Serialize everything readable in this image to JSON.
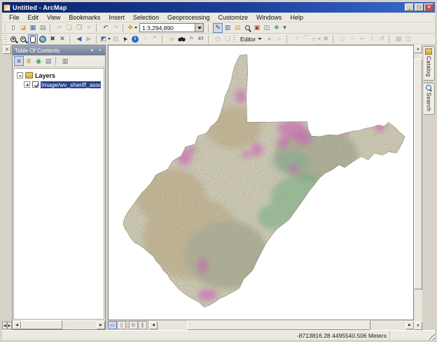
{
  "window": {
    "title": "Untitled - ArcMap"
  },
  "titlebar_controls": [
    {
      "name": "minimize-button",
      "glyph": "_"
    },
    {
      "name": "maximize-button",
      "glyph": "□"
    },
    {
      "name": "close-button",
      "glyph": "×"
    }
  ],
  "menu": {
    "items": [
      {
        "name": "menu-file",
        "label": "File"
      },
      {
        "name": "menu-edit",
        "label": "Edit"
      },
      {
        "name": "menu-view",
        "label": "View"
      },
      {
        "name": "menu-bookmarks",
        "label": "Bookmarks"
      },
      {
        "name": "menu-insert",
        "label": "Insert"
      },
      {
        "name": "menu-selection",
        "label": "Selection"
      },
      {
        "name": "menu-geoprocessing",
        "label": "Geoprocessing"
      },
      {
        "name": "menu-customize",
        "label": "Customize"
      },
      {
        "name": "menu-windows",
        "label": "Windows"
      },
      {
        "name": "menu-help",
        "label": "Help"
      }
    ]
  },
  "standard_toolbar": {
    "scale_value": "1:3,294,890",
    "buttons_left": [
      {
        "name": "new-map-button",
        "glyph": "▯",
        "color": "#556"
      },
      {
        "name": "open-button",
        "glyph": "◪",
        "color": "#d9a33c"
      },
      {
        "name": "save-button",
        "glyph": "▦",
        "color": "#3b5fc0"
      },
      {
        "name": "print-button",
        "glyph": "▤",
        "color": "#7d8494"
      },
      {
        "sep": true
      },
      {
        "name": "cut-button",
        "glyph": "✂",
        "color": "#556",
        "disabled": true
      },
      {
        "name": "copy-button",
        "glyph": "❏",
        "color": "#556",
        "disabled": true
      },
      {
        "name": "paste-button",
        "glyph": "❒",
        "color": "#b9862f"
      },
      {
        "name": "delete-button",
        "glyph": "×",
        "color": "#a33",
        "disabled": true
      },
      {
        "sep": true
      },
      {
        "name": "undo-button",
        "glyph": "↶",
        "color": "#2f58c2"
      },
      {
        "name": "redo-button",
        "glyph": "↷",
        "color": "#667",
        "disabled": true
      },
      {
        "sep": true
      },
      {
        "name": "add-data-button",
        "glyph": "✚",
        "color": "#caa225",
        "dd": true
      }
    ],
    "buttons_right": [
      {
        "name": "editor-toolbar-toggle-button",
        "glyph": "✎",
        "color": "#445",
        "pressed": true
      },
      {
        "name": "table-of-contents-window-button",
        "glyph": "▥",
        "color": "#3b5fc0"
      },
      {
        "name": "catalog-window-button",
        "glyph": "▤",
        "color": "#d9a33c"
      },
      {
        "name": "search-window-button",
        "cls": "ico-magnifier"
      },
      {
        "name": "arctoolbox-window-button",
        "glyph": "▣",
        "color": "#c23b2f"
      },
      {
        "name": "python-window-button",
        "glyph": "◫",
        "color": "#667"
      },
      {
        "name": "modelbuilder-button",
        "glyph": "❖",
        "color": "#3aa05a"
      },
      {
        "name": "toolbar-overflow-button",
        "glyph": "▾",
        "color": "#556",
        "cls": "overflow"
      }
    ]
  },
  "tools_toolbar": {
    "buttons": [
      {
        "name": "zoom-in-button",
        "cls": "ico-zoom-in"
      },
      {
        "name": "zoom-out-button",
        "cls": "ico-zoom-out"
      },
      {
        "name": "pan-button",
        "cls": "ico-hand",
        "pressed": true
      },
      {
        "name": "full-extent-button",
        "cls": "ico-globe"
      },
      {
        "name": "fixed-zoom-in-button",
        "glyph": "✖",
        "color": "#2f3f66"
      },
      {
        "name": "fixed-zoom-out-button",
        "glyph": "✕",
        "color": "#2f3f66"
      },
      {
        "sep": true
      },
      {
        "name": "go-back-extent-button",
        "glyph": "◀",
        "color": "#2f58c2"
      },
      {
        "name": "go-forward-extent-button",
        "glyph": "▶",
        "color": "#667",
        "disabled": true
      },
      {
        "sep": true
      },
      {
        "name": "select-features-button",
        "glyph": "◩",
        "color": "#5a6ab0",
        "dd": true
      },
      {
        "name": "clear-selection-button",
        "glyph": "▨",
        "color": "#667",
        "disabled": true
      },
      {
        "name": "select-elements-button",
        "glyph": "➤",
        "color": "#1a1a1a",
        "cls": "rot-up"
      },
      {
        "name": "identify-button",
        "glyph": "i",
        "cls": "ico-info"
      },
      {
        "name": "hyperlink-button",
        "glyph": "⚡",
        "color": "#caa225",
        "disabled": true
      },
      {
        "name": "html-popup-button",
        "glyph": "❞",
        "color": "#667",
        "disabled": true
      },
      {
        "sep": true
      },
      {
        "name": "measure-button",
        "glyph": "▱",
        "color": "#b9862f"
      },
      {
        "name": "find-button",
        "cls": "ico-binoculars"
      },
      {
        "name": "find-route-button",
        "glyph": "⚑",
        "color": "#667",
        "disabled": true
      },
      {
        "name": "go-to-xy-button",
        "glyph": "XY",
        "color": "#2f58c2",
        "cls": "txt"
      },
      {
        "sep": true
      },
      {
        "name": "time-slider-button",
        "glyph": "◷",
        "color": "#667",
        "disabled": true
      },
      {
        "name": "create-viewer-window-button",
        "glyph": "❏",
        "color": "#667",
        "disabled": true
      }
    ]
  },
  "editor_toolbar": {
    "label": "Editor",
    "buttons": [
      {
        "name": "edit-tool-button",
        "glyph": "▸",
        "color": "#667",
        "disabled": true
      },
      {
        "name": "edit-annotation-tool-button",
        "glyph": "▹",
        "color": "#667",
        "disabled": true
      },
      {
        "sep": true
      },
      {
        "name": "straight-segment-button",
        "glyph": "/",
        "color": "#667",
        "disabled": true
      },
      {
        "name": "endpoint-arc-button",
        "glyph": "⌒",
        "color": "#667",
        "disabled": true
      },
      {
        "name": "trace-button",
        "glyph": "▱",
        "color": "#667",
        "disabled": true,
        "dd": true
      },
      {
        "name": "point-tool-button",
        "glyph": "✱",
        "color": "#667",
        "disabled": true
      },
      {
        "sep": true
      },
      {
        "name": "edit-vertices-button",
        "glyph": "◇",
        "color": "#667",
        "disabled": true
      },
      {
        "name": "reshape-feature-button",
        "glyph": "~",
        "color": "#667",
        "disabled": true
      },
      {
        "name": "cut-polygons-button",
        "glyph": "✂",
        "color": "#667",
        "disabled": true
      },
      {
        "name": "split-tool-button",
        "glyph": "/",
        "color": "#667",
        "disabled": true
      },
      {
        "name": "rotate-tool-button",
        "glyph": "↺",
        "color": "#667",
        "disabled": true
      },
      {
        "sep": true
      },
      {
        "name": "attributes-button",
        "glyph": "▦",
        "color": "#667",
        "disabled": true
      },
      {
        "name": "sketch-properties-button",
        "glyph": "◫",
        "color": "#667",
        "disabled": true
      }
    ]
  },
  "toc": {
    "title": "Table Of Contents",
    "toolbar": [
      {
        "name": "list-by-drawing-order-button",
        "glyph": "≡",
        "color": "#334",
        "pressed": true
      },
      {
        "name": "list-by-source-button",
        "glyph": "≣",
        "color": "#b9862f"
      },
      {
        "name": "list-by-visibility-button",
        "glyph": "◉",
        "color": "#3aa05a"
      },
      {
        "name": "list-by-selection-button",
        "glyph": "▤",
        "color": "#5a6ab0"
      },
      {
        "sep": true
      },
      {
        "name": "toc-options-button",
        "glyph": "▥",
        "color": "#667"
      }
    ],
    "pin_glyph": "▾",
    "close_glyph": "×",
    "root_label": "Layers",
    "layer_name": "Image/wv_sheriff_associatio",
    "layer_checked": true
  },
  "side_tabs": [
    {
      "name": "tab-catalog",
      "label": "Catalog"
    },
    {
      "name": "tab-search",
      "label": "Search"
    }
  ],
  "map_bottom_buttons": [
    {
      "name": "data-view-button",
      "glyph": "▭",
      "color": "#3b5fc0",
      "pressed": true
    },
    {
      "name": "layout-view-button",
      "glyph": "▯",
      "color": "#667"
    },
    {
      "name": "refresh-view-button",
      "glyph": "↻",
      "color": "#2f58c2",
      "cls": "sepgap"
    },
    {
      "name": "pause-drawing-button",
      "glyph": "∥",
      "color": "#2f58c2"
    }
  ],
  "glyphs": {
    "up": "▲",
    "down": "▼",
    "left": "◀",
    "right": "▶",
    "strip_close": "×"
  },
  "status": {
    "coordinates": "-8713816.28  4495540.506 Meters"
  },
  "map": {
    "region": "West Virginia",
    "content": "classified raster imagery covering the state of West Virginia",
    "base_color": "#8f7d52",
    "patch_colors": {
      "green": "#3aa060",
      "teal": "#2f9f86",
      "magenta": "#cf2fbe",
      "brown": "#a07838",
      "dark": "#55603a"
    }
  }
}
